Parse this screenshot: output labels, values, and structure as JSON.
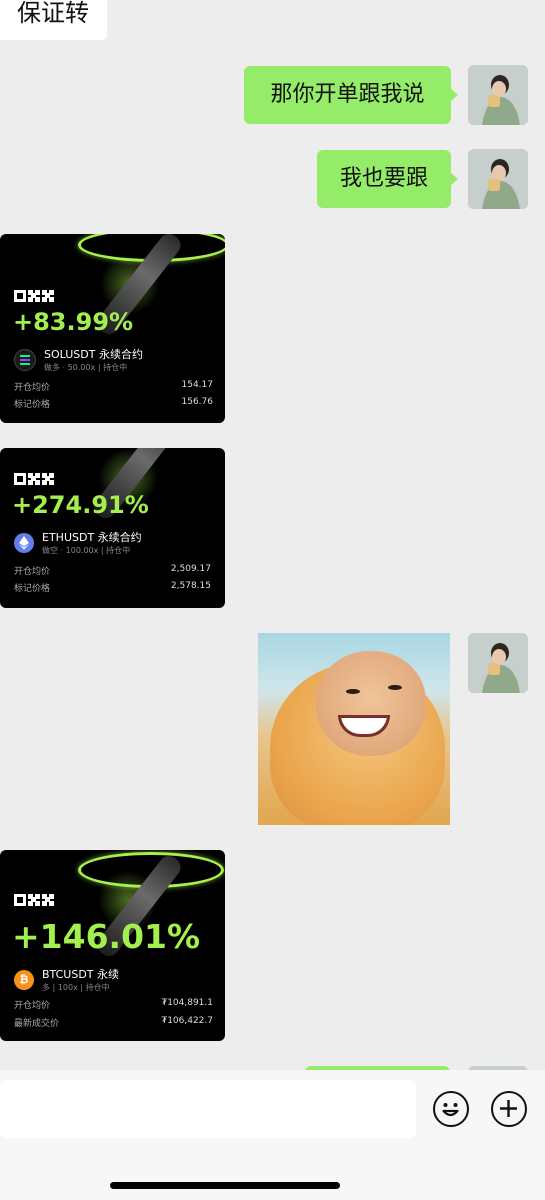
{
  "chat": {
    "top_partial_message": "保证转",
    "outgoing": [
      {
        "text": "那你开单跟我说"
      },
      {
        "text": "我也要跟"
      }
    ]
  },
  "cards": [
    {
      "brand": "OKX",
      "pnl": "+83.99%",
      "symbol": "SOLUSDT 永续合约",
      "side": "做多",
      "leverage": "50.00x",
      "status": "持仓中",
      "coin_color": "#1b1b1b",
      "rows": [
        {
          "label": "开仓均价",
          "value": "154.17"
        },
        {
          "label": "标记价格",
          "value": "156.76"
        }
      ]
    },
    {
      "brand": "OKX",
      "pnl": "+274.91%",
      "symbol": "ETHUSDT 永续合约",
      "side": "做空",
      "leverage": "100.00x",
      "status": "持仓中",
      "coin_color": "#627eea",
      "rows": [
        {
          "label": "开仓均价",
          "value": "2,509.17"
        },
        {
          "label": "标记价格",
          "value": "2,578.15"
        }
      ]
    },
    {
      "brand": "OKX",
      "pnl": "+146.01%",
      "symbol": "BTCUSDT 永续",
      "side": "多",
      "leverage": "100x",
      "status": "持仓中",
      "coin_color": "#f7931a",
      "rows": [
        {
          "label": "开仓均价",
          "value": "₮104,891.1"
        },
        {
          "label": "最新成交价",
          "value": "₮106,422.7"
        }
      ]
    }
  ],
  "icons": {
    "emoji": "emoji-icon",
    "plus": "plus-icon"
  },
  "colors": {
    "chat_bg": "#ededed",
    "outgoing_bubble": "#95ec69",
    "pnl_green": "#a3ef4f"
  }
}
